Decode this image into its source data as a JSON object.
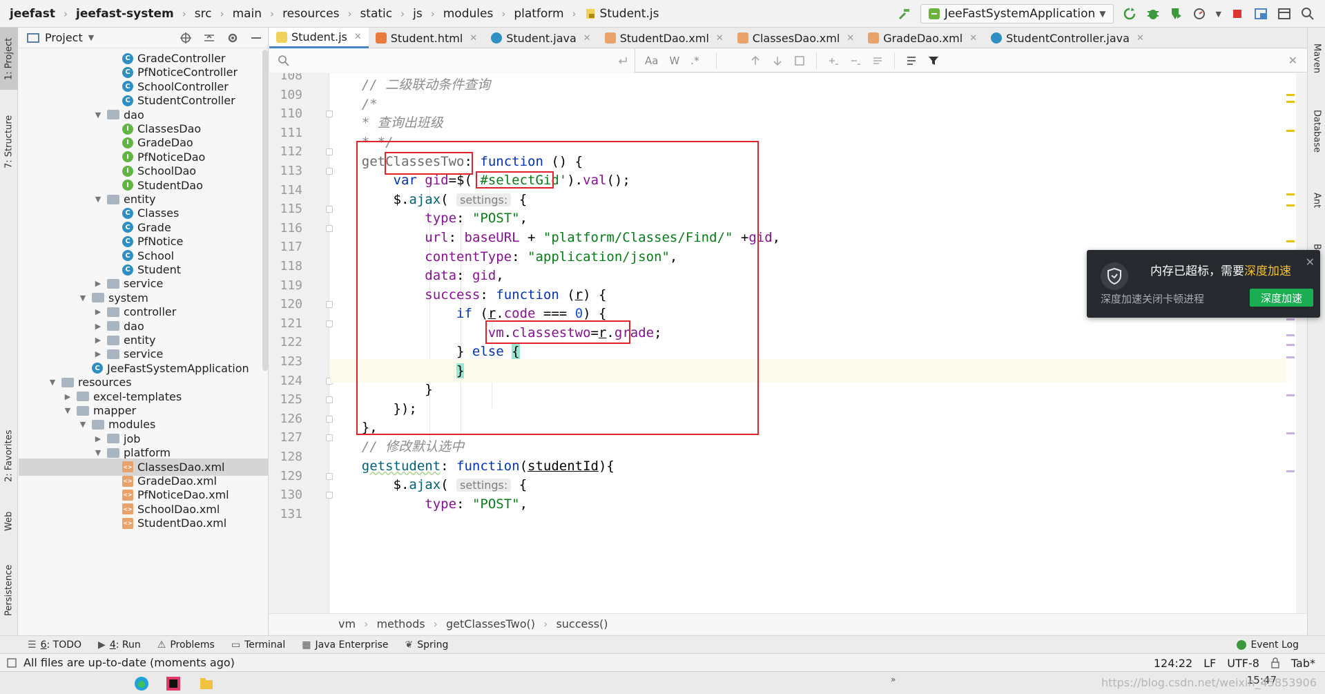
{
  "navbar": {
    "crumbs": [
      "jeefast",
      "jeefast-system",
      "src",
      "main",
      "resources",
      "static",
      "js",
      "modules",
      "platform",
      "Student.js"
    ],
    "run_config": "JeeFastSystemApplication"
  },
  "left_strip": {
    "project": "1: Project",
    "structure": "7: Structure",
    "favorites": "2: Favorites",
    "web": "Web",
    "persistence": "Persistence"
  },
  "right_strip": {
    "maven": "Maven",
    "database": "Database",
    "ant": "Ant",
    "bean": "Bean"
  },
  "project": {
    "title": "Project",
    "tree": [
      {
        "label": "GradeController",
        "icon": "class",
        "level": 5
      },
      {
        "label": "PfNoticeController",
        "icon": "class",
        "level": 5
      },
      {
        "label": "SchoolController",
        "icon": "class",
        "level": 5
      },
      {
        "label": "StudentController",
        "icon": "class",
        "level": 5
      },
      {
        "label": "dao",
        "icon": "folder",
        "level": 4,
        "expanded": true
      },
      {
        "label": "ClassesDao",
        "icon": "interface",
        "level": 5
      },
      {
        "label": "GradeDao",
        "icon": "interface",
        "level": 5
      },
      {
        "label": "PfNoticeDao",
        "icon": "interface",
        "level": 5
      },
      {
        "label": "SchoolDao",
        "icon": "interface",
        "level": 5
      },
      {
        "label": "StudentDao",
        "icon": "interface",
        "level": 5
      },
      {
        "label": "entity",
        "icon": "folder",
        "level": 4,
        "expanded": true
      },
      {
        "label": "Classes",
        "icon": "class",
        "level": 5
      },
      {
        "label": "Grade",
        "icon": "class",
        "level": 5
      },
      {
        "label": "PfNotice",
        "icon": "class",
        "level": 5
      },
      {
        "label": "School",
        "icon": "class",
        "level": 5
      },
      {
        "label": "Student",
        "icon": "class",
        "level": 5
      },
      {
        "label": "service",
        "icon": "folder",
        "level": 4,
        "expanded": false
      },
      {
        "label": "system",
        "icon": "folder",
        "level": 3,
        "expanded": true
      },
      {
        "label": "controller",
        "icon": "folder",
        "level": 4,
        "expanded": false
      },
      {
        "label": "dao",
        "icon": "folder",
        "level": 4,
        "expanded": false
      },
      {
        "label": "entity",
        "icon": "folder",
        "level": 4,
        "expanded": false
      },
      {
        "label": "service",
        "icon": "folder",
        "level": 4,
        "expanded": false
      },
      {
        "label": "JeeFastSystemApplication",
        "icon": "app",
        "level": 3
      },
      {
        "label": "resources",
        "icon": "folder",
        "level": 1,
        "expanded": true
      },
      {
        "label": "excel-templates",
        "icon": "folder",
        "level": 2,
        "expanded": false
      },
      {
        "label": "mapper",
        "icon": "folder",
        "level": 2,
        "expanded": true
      },
      {
        "label": "modules",
        "icon": "folder",
        "level": 3,
        "expanded": true
      },
      {
        "label": "job",
        "icon": "folder",
        "level": 4,
        "expanded": false
      },
      {
        "label": "platform",
        "icon": "folder",
        "level": 4,
        "expanded": true
      },
      {
        "label": "ClassesDao.xml",
        "icon": "xml",
        "level": 5,
        "selected": true
      },
      {
        "label": "GradeDao.xml",
        "icon": "xml",
        "level": 5
      },
      {
        "label": "PfNoticeDao.xml",
        "icon": "xml",
        "level": 5
      },
      {
        "label": "SchoolDao.xml",
        "icon": "xml",
        "level": 5
      },
      {
        "label": "StudentDao.xml",
        "icon": "xml",
        "level": 5
      }
    ]
  },
  "tabs": [
    {
      "label": "Student.js",
      "icon": "js",
      "active": true
    },
    {
      "label": "Student.html",
      "icon": "html"
    },
    {
      "label": "Student.java",
      "icon": "class"
    },
    {
      "label": "StudentDao.xml",
      "icon": "xml"
    },
    {
      "label": "ClassesDao.xml",
      "icon": "xml"
    },
    {
      "label": "GradeDao.xml",
      "icon": "xml"
    },
    {
      "label": "StudentController.java",
      "icon": "class"
    }
  ],
  "search": {
    "placeholder": "",
    "match_case": "Aa",
    "words": "W",
    "regex": ".*"
  },
  "editor": {
    "line_numbers": [
      "108",
      "109",
      "110",
      "111",
      "112",
      "113",
      "114",
      "115",
      "116",
      "117",
      "118",
      "119",
      "120",
      "121",
      "122",
      "123",
      "124",
      "125",
      "126",
      "127",
      "128",
      "129",
      "130",
      "131"
    ],
    "current_line": "124",
    "hint_settings": "settings:"
  },
  "breadcrumb": [
    "vm",
    "methods",
    "getClassesTwo()",
    "success()"
  ],
  "popup": {
    "title_prefix": "内存已超标，需要",
    "title_highlight": "深度加速",
    "subtitle": "深度加速关闭卡顿进程",
    "button": "深度加速"
  },
  "tool_tabs": [
    {
      "num": "6",
      "label": ": TODO"
    },
    {
      "num": "4",
      "label": ": Run"
    },
    {
      "num": "",
      "label": "Problems"
    },
    {
      "num": "",
      "label": "Terminal"
    },
    {
      "num": "",
      "label": "Java Enterprise"
    },
    {
      "num": "",
      "label": "Spring"
    }
  ],
  "event_log": "Event Log",
  "status": {
    "message": "All files are up-to-date (moments ago)",
    "position": "124:22",
    "line_sep": "LF",
    "encoding": "UTF-8",
    "indent": "Tab*"
  },
  "taskbar": {
    "time": "15:47",
    "watermark": "https://blog.csdn.net/weixin_45853906"
  },
  "colors": {
    "accent": "#4a86c7",
    "annotation_red": "#e0232a",
    "popup_green": "#1aad52",
    "popup_highlight": "#f5c12c"
  }
}
